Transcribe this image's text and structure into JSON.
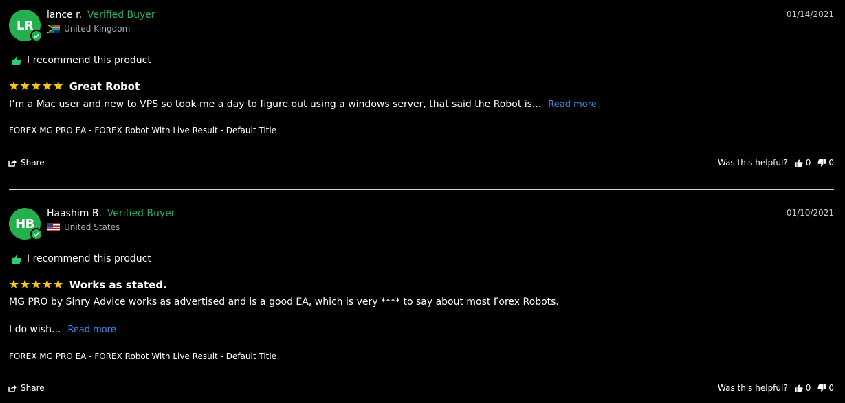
{
  "reviews": [
    {
      "initials": "LR",
      "name": "lance r.",
      "verified": "Verified Buyer",
      "country": "United Kingdom",
      "date": "01/14/2021",
      "recommend": "I recommend this product",
      "stars": "★★★★★",
      "title": "Great Robot",
      "body": "I’m a Mac user and new to VPS so took me a day to figure out using a windows server, that said the Robot is...",
      "read_more": "Read more",
      "product": "FOREX MG PRO EA - FOREX Robot With Live Result - Default Title",
      "share": "Share",
      "helpful_label": "Was this helpful?",
      "up_count": "0",
      "down_count": "0"
    },
    {
      "initials": "HB",
      "name": "Haashim B.",
      "verified": "Verified Buyer",
      "country": "United States",
      "date": "01/10/2021",
      "recommend": "I recommend this product",
      "stars": "★★★★★",
      "title": "Works as stated.",
      "body": "MG PRO by Sinry Advice works as advertised and is a good EA, which is very **** to say about most Forex Robots.",
      "body2": "I do wish...",
      "read_more": "Read more",
      "product": "FOREX MG PRO EA - FOREX Robot With Live Result - Default Title",
      "share": "Share",
      "helpful_label": "Was this helpful?",
      "up_count": "0",
      "down_count": "0"
    }
  ]
}
